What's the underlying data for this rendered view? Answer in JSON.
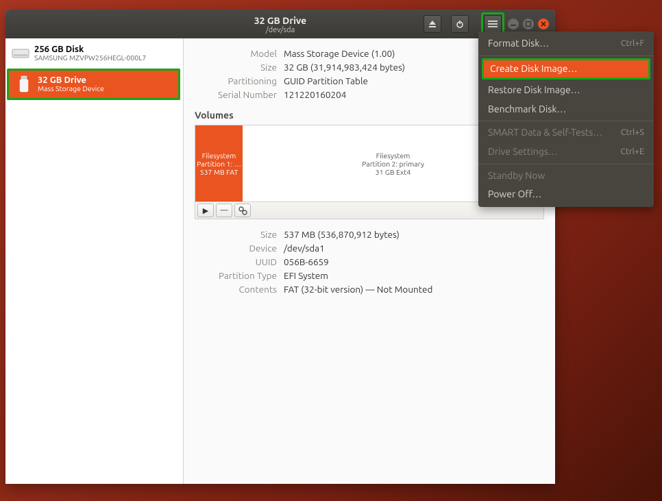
{
  "header": {
    "title": "32 GB Drive",
    "subtitle": "/dev/sda"
  },
  "sidebar": {
    "disks": [
      {
        "name": "256 GB Disk",
        "sub": "SAMSUNG MZVPW256HEGL-000L7"
      },
      {
        "name": "32 GB Drive",
        "sub": "Mass Storage Device"
      }
    ]
  },
  "info": {
    "model_label": "Model",
    "model": "Mass Storage Device (1.00)",
    "size_label": "Size",
    "size": "32 GB (31,914,983,424 bytes)",
    "partitioning_label": "Partitioning",
    "partitioning": "GUID Partition Table",
    "serial_label": "Serial Number",
    "serial": "121220160204"
  },
  "volumes": {
    "heading": "Volumes",
    "v1_line1": "Filesystem",
    "v1_line2": "Partition 1: …",
    "v1_line3": "537 MB FAT",
    "v2_line1": "Filesystem",
    "v2_line2": "Partition 2: primary",
    "v2_line3": "31 GB Ext4"
  },
  "vol_details": {
    "size_label": "Size",
    "size": "537 MB (536,870,912 bytes)",
    "device_label": "Device",
    "device": "/dev/sda1",
    "uuid_label": "UUID",
    "uuid": "056B-6659",
    "ptype_label": "Partition Type",
    "ptype": "EFI System",
    "contents_label": "Contents",
    "contents": "FAT (32-bit version) — Not Mounted"
  },
  "menu": {
    "format": "Format Disk…",
    "format_accel": "Ctrl+F",
    "create_image": "Create Disk Image…",
    "restore_image": "Restore Disk Image…",
    "benchmark": "Benchmark Disk…",
    "smart": "SMART Data & Self-Tests…",
    "smart_accel": "Ctrl+S",
    "settings": "Drive Settings…",
    "settings_accel": "Ctrl+E",
    "standby": "Standby Now",
    "poweroff": "Power Off…"
  }
}
